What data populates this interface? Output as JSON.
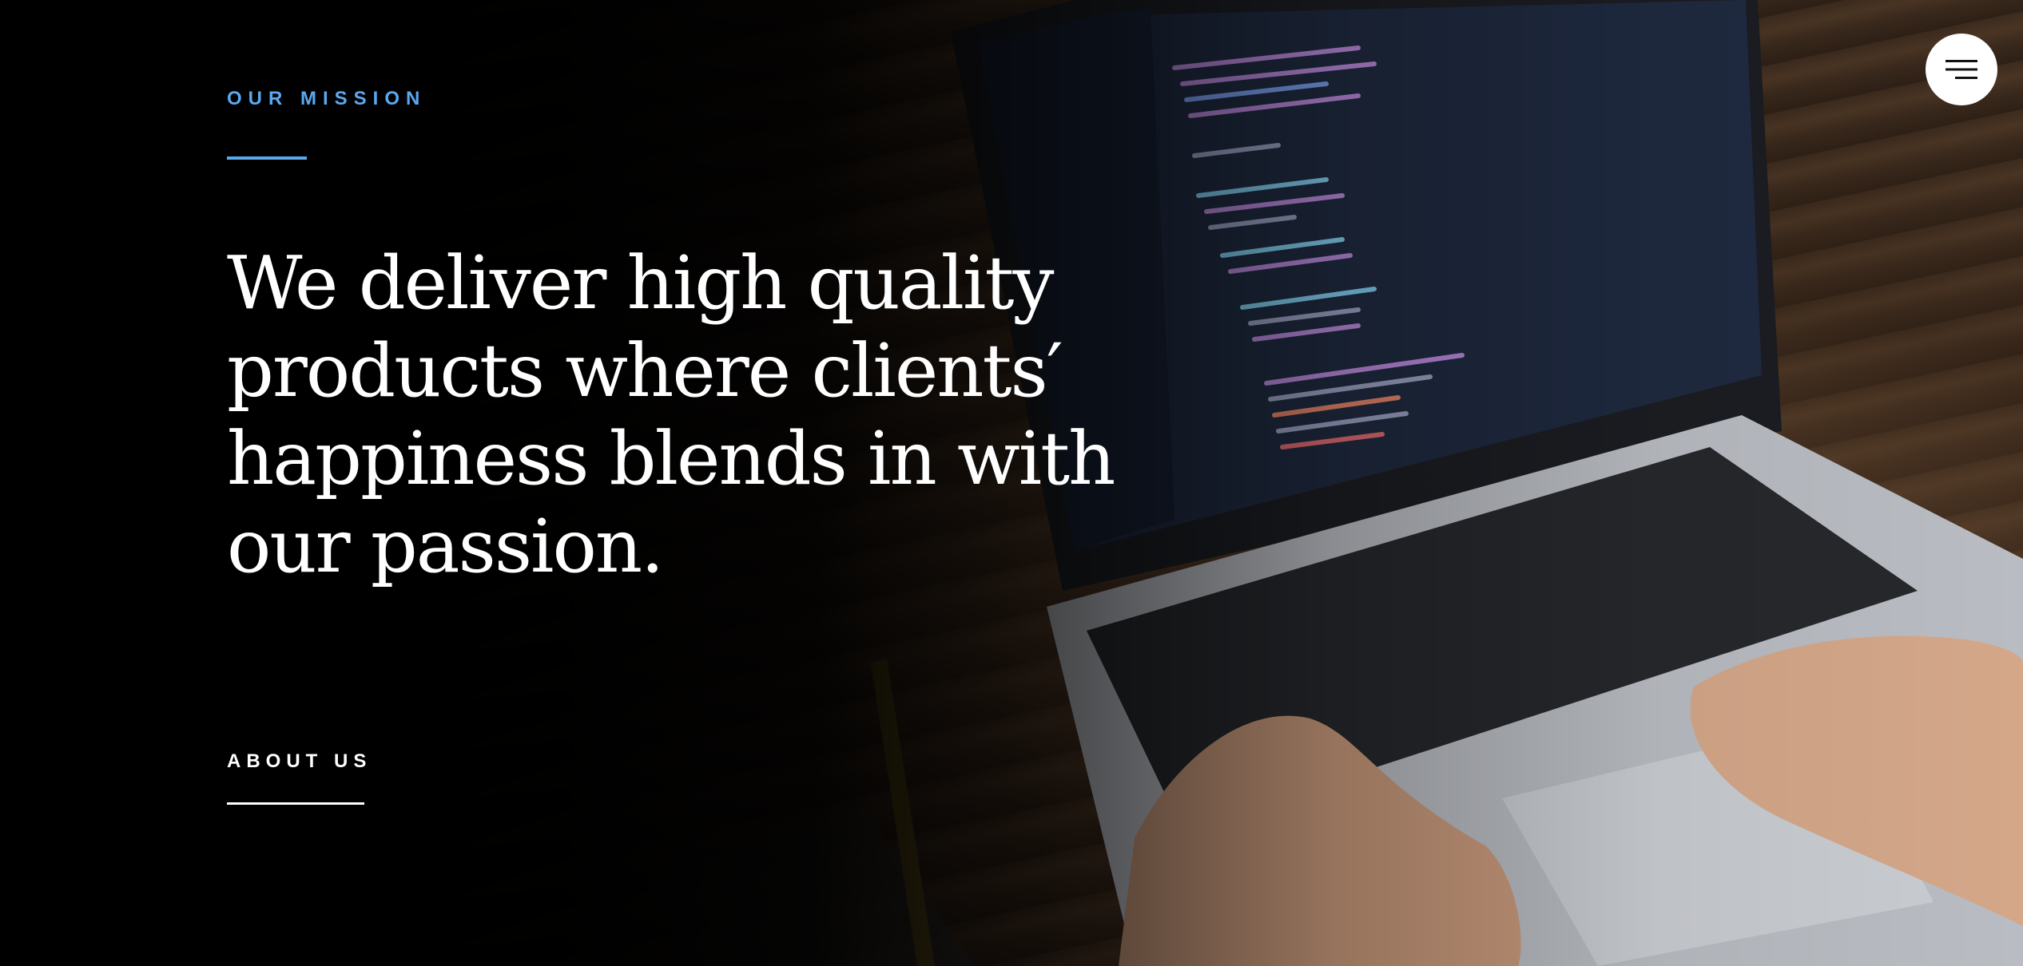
{
  "hero": {
    "eyebrow": "OUR MISSION",
    "headline": "We deliver high quality products where clients′ happiness blends in with our passion.",
    "cta_label": "ABOUT US"
  },
  "nav": {
    "menu_icon": "hamburger-menu-icon"
  },
  "colors": {
    "accent": "#5aa9f0",
    "text": "#ffffff",
    "background": "#000000",
    "menu_button_bg": "#ffffff"
  }
}
